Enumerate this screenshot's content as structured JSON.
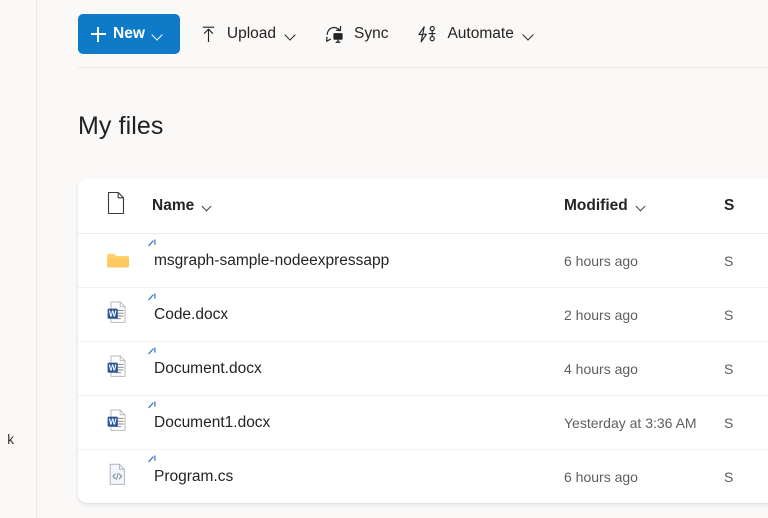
{
  "app": {
    "accent_color": "#0f7ac8",
    "background_color": "#faf9f8",
    "card_color": "#ffffff"
  },
  "sidebar": {
    "clipped_label": "k"
  },
  "commandbar": {
    "new_button": {
      "label": "New",
      "icon": "plus-icon",
      "chevron": "chevron-down-icon"
    },
    "items": [
      {
        "label": "Upload",
        "icon": "upload-arrow-icon",
        "has_chevron": true
      },
      {
        "label": "Sync",
        "icon": "sync-icon",
        "has_chevron": false
      },
      {
        "label": "Automate",
        "icon": "automate-icon",
        "has_chevron": true
      }
    ]
  },
  "page": {
    "title": "My files"
  },
  "filelist": {
    "columns": [
      {
        "key": "icon",
        "label": "",
        "icon": "document-icon",
        "sortable": false
      },
      {
        "key": "name",
        "label": "Name",
        "sortable": true
      },
      {
        "key": "modified",
        "label": "Modified",
        "sortable": true
      },
      {
        "key": "third",
        "label": "S",
        "sortable": true
      }
    ],
    "rows": [
      {
        "name": "msgraph-sample-nodeexpressapp",
        "icon": "folder-icon",
        "modified": "6 hours ago",
        "third": "S",
        "badge": "sparkle-icon"
      },
      {
        "name": "Code.docx",
        "icon": "word-document-icon",
        "modified": "2 hours ago",
        "third": "S",
        "badge": "sparkle-icon"
      },
      {
        "name": "Document.docx",
        "icon": "word-document-icon",
        "modified": "4 hours ago",
        "third": "S",
        "badge": "sparkle-icon"
      },
      {
        "name": "Document1.docx",
        "icon": "word-document-icon",
        "modified": "Yesterday at 3:36 AM",
        "third": "S",
        "badge": "sparkle-icon"
      },
      {
        "name": "Program.cs",
        "icon": "code-file-icon",
        "modified": "6 hours ago",
        "third": "S",
        "badge": "sparkle-icon"
      }
    ]
  }
}
